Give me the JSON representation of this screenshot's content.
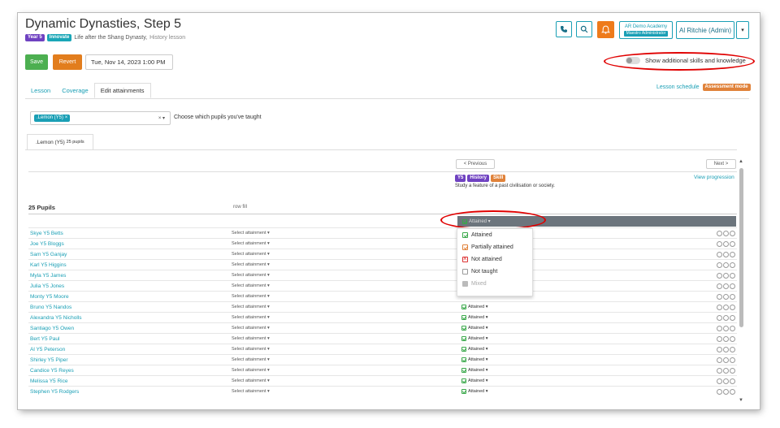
{
  "header": {
    "title": "Dynamic Dynasties, Step 5",
    "year_tag": "Year 5",
    "innovate_tag": "Innovate",
    "subtitle": "Life after the Shang Dynasty,",
    "lesson_type": "History lesson",
    "academy_name": "AR Demo Academy",
    "academy_role": "Maestro Administrator",
    "user_name": "Al Ritchie (Admin)"
  },
  "toolbar": {
    "save_label": "Save",
    "revert_label": "Revert",
    "date_value": "Tue, Nov 14, 2023 1:00 PM",
    "toggle_label": "Show additional skills and knowledge"
  },
  "tabs": [
    {
      "label": "Lesson"
    },
    {
      "label": "Coverage"
    },
    {
      "label": "Edit attainments"
    }
  ],
  "lesson_schedule": {
    "label": "Lesson schedule",
    "badge": "Assessment mode"
  },
  "class_select": {
    "chip": ".Lemon (Y5)",
    "chip_close": "×",
    "clear": "× ▾",
    "hint": "Choose which pupils you've taught"
  },
  "class_tab": {
    "name": ".Lemon (Y5)",
    "count": "25 pupils"
  },
  "pager": {
    "previous": "< Previous",
    "next": "Next >"
  },
  "objective": {
    "tags": [
      "Y5",
      "History",
      "Skill"
    ],
    "text": "Study a feature of a past civilisation or society.",
    "view_progression": "View progression"
  },
  "table": {
    "pupils_heading": "25 Pupils",
    "row_fill": "row fill",
    "fill_value": "Attained ▾"
  },
  "menu": {
    "items": [
      "Attained",
      "Partially attained",
      "Not attained",
      "Not taught",
      "Mixed"
    ]
  },
  "rows": [
    {
      "name": "Skye Y5 Betts",
      "select": "Select attainment ▾",
      "att": ""
    },
    {
      "name": "Joe Y5 Bloggs",
      "select": "Select attainment ▾",
      "att": ""
    },
    {
      "name": "Sam Y5 Ganjay",
      "select": "Select attainment ▾",
      "att": ""
    },
    {
      "name": "Karl Y5 Higgins",
      "select": "Select attainment ▾",
      "att": ""
    },
    {
      "name": "Myla Y5 James",
      "select": "Select attainment ▾",
      "att": ""
    },
    {
      "name": "Julia Y5 Jones",
      "select": "Select attainment ▾",
      "att": ""
    },
    {
      "name": "Monty Y5 Moore",
      "select": "Select attainment ▾",
      "att": ""
    },
    {
      "name": "Bruno Y5 Nandos",
      "select": "Select attainment ▾",
      "att": "Attained ▾"
    },
    {
      "name": "Alexandra Y5 Nicholls",
      "select": "Select attainment ▾",
      "att": "Attained ▾"
    },
    {
      "name": "Santiago Y5 Owen",
      "select": "Select attainment ▾",
      "att": "Attained ▾"
    },
    {
      "name": "Bert Y5 Paul",
      "select": "Select attainment ▾",
      "att": "Attained ▾"
    },
    {
      "name": "Al Y5 Peterson",
      "select": "Select attainment ▾",
      "att": "Attained ▾"
    },
    {
      "name": "Shirley Y5 Piper",
      "select": "Select attainment ▾",
      "att": "Attained ▾"
    },
    {
      "name": "Candice Y5 Reyes",
      "select": "Select attainment ▾",
      "att": "Attained ▾"
    },
    {
      "name": "Melissa Y5 Rice",
      "select": "Select attainment ▾",
      "att": "Attained ▾"
    },
    {
      "name": "Stephen Y5 Rodgers",
      "select": "Select attainment ▾",
      "att": "Attained ▾"
    }
  ],
  "colors": {
    "accent": "#1a9fb5",
    "save": "#4caf50",
    "revert": "#e27d1d",
    "highlight": "#e00000"
  }
}
